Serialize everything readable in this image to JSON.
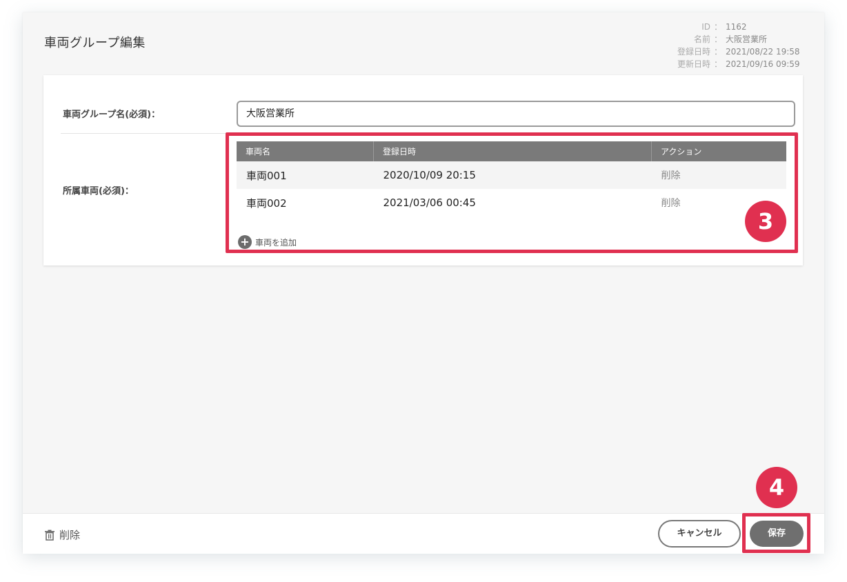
{
  "page_title": "車両グループ編集",
  "meta": {
    "rows": [
      {
        "key": "ID",
        "value": "1162"
      },
      {
        "key": "名前",
        "value": "大阪営業所"
      },
      {
        "key": "登録日時",
        "value": "2021/08/22 19:58"
      },
      {
        "key": "更新日時",
        "value": "2021/09/16 09:59"
      }
    ],
    "separator": "："
  },
  "form": {
    "group_name_label": "車両グループ名(必須)：",
    "group_name_value": "大阪営業所",
    "vehicles_label": "所属車両(必須)："
  },
  "table": {
    "headers": [
      "車両名",
      "登録日時",
      "アクション"
    ],
    "rows": [
      {
        "name": "車両001",
        "registered": "2020/10/09 20:15",
        "action": "削除"
      },
      {
        "name": "車両002",
        "registered": "2021/03/06 00:45",
        "action": "削除"
      }
    ],
    "add_label": "車両を追加"
  },
  "annotations": {
    "badge_3": "3",
    "badge_4": "4",
    "color": "#e03050"
  },
  "footer": {
    "delete_label": "削除",
    "cancel_label": "キャンセル",
    "save_label": "保存"
  },
  "icons": {
    "delete": "trash-icon",
    "add": "plus-circle-icon"
  },
  "colors": {
    "header_bg": "#7a7a7a",
    "save_bg": "#6f6f6f",
    "highlight": "#e03050"
  }
}
